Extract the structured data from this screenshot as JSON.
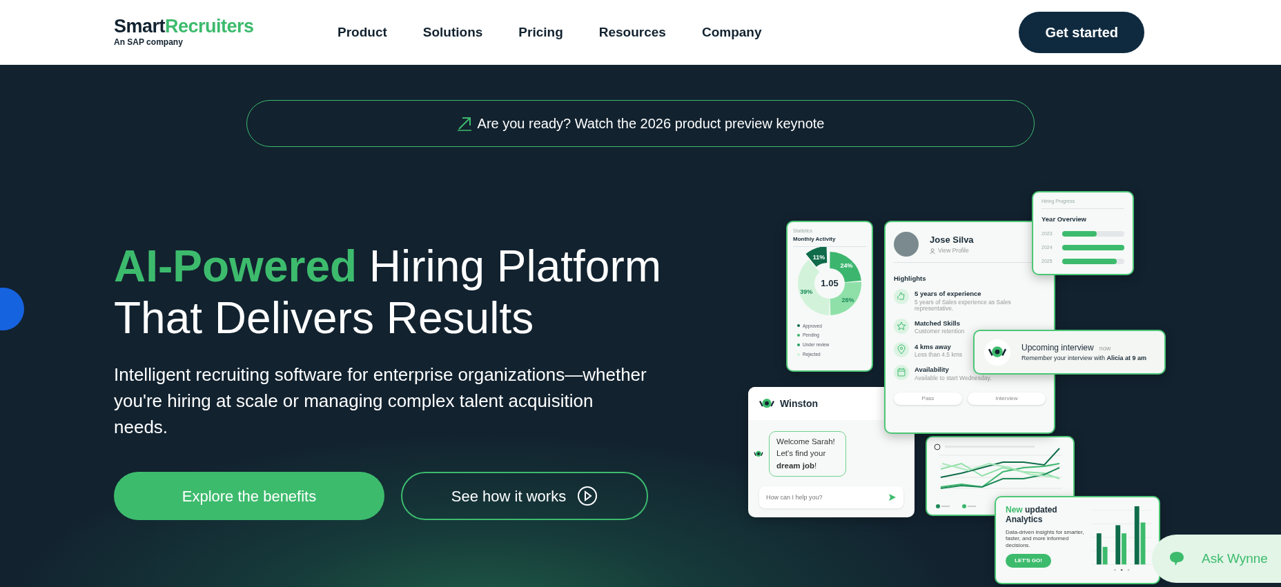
{
  "nav": {
    "logo_primary": "Smart",
    "logo_accent": "Recruiters",
    "logo_sub": "An SAP company",
    "links": [
      "Product",
      "Solutions",
      "Pricing",
      "Resources",
      "Company"
    ],
    "cta": "Get started"
  },
  "banner": {
    "text": "Are you ready? Watch the 2026 product preview keynote"
  },
  "hero": {
    "title_accent": "AI-Powered",
    "title_rest": "Hiring Platform That Delivers Results",
    "subtitle": "Intelligent recruiting software for enterprise organizations—whether you're hiring at scale or managing complex talent acquisition needs.",
    "buttons": [
      {
        "label": "Explore the benefits",
        "kind": "primary"
      },
      {
        "label": "See how it works",
        "kind": "outline"
      }
    ]
  },
  "collage": {
    "statistics": {
      "label": "Statistics",
      "title": "Monthly Activity",
      "center_value": "1.05",
      "chart_data": {
        "type": "donut",
        "values": [
          11,
          24,
          26,
          39
        ],
        "value_labels": [
          "11%",
          "24%",
          "26%",
          "39%"
        ],
        "data_labels": true
      },
      "legend": [
        {
          "label": "Approved",
          "color": "#0f6b4a"
        },
        {
          "label": "Pending",
          "color": "#3cb66e"
        },
        {
          "label": "Under review",
          "color": "#22a060"
        },
        {
          "label": "Rejected",
          "color": "#d2f3da"
        }
      ]
    },
    "profile": {
      "name": "Jose Silva",
      "link": "View Profile",
      "section": "Highlights",
      "highlights": [
        {
          "kind": "thumb",
          "title": "5 years of experience",
          "text": "5 years of Sales experience as Sales representative."
        },
        {
          "kind": "star",
          "title": "Matched Skills",
          "text": "Customer retention"
        },
        {
          "kind": "pin",
          "title": "4 kms away",
          "text": "Less than 4.5 kms"
        },
        {
          "kind": "calendar",
          "title": "Availability",
          "text": "Available to start Wednesday."
        }
      ],
      "actions": [
        "Pass",
        "Interview"
      ]
    },
    "hiring_progress": {
      "label": "Hiring Progress",
      "title": "Year Overview",
      "rows": [
        {
          "year": "2023",
          "level": 0.55
        },
        {
          "year": "2024",
          "level": 1.0
        },
        {
          "year": "2025",
          "level": 0.88
        }
      ]
    },
    "notification": {
      "title": "Upcoming interview",
      "time": "now",
      "message": "Remember your interview with **Alicia at 9 am**"
    },
    "chat": {
      "name": "Winston",
      "message": "Welcome Sarah! Let's find your **dream job**!",
      "placeholder": "How can I help you?"
    },
    "analytics": {
      "title_accent": "New",
      "title_rest": "updated Analytics",
      "text": "Data-driven insights for smarter, faster, and more informed decisions.",
      "button": "LET'S GO!"
    }
  },
  "chat_widget": {
    "label": "Ask Wynne"
  }
}
